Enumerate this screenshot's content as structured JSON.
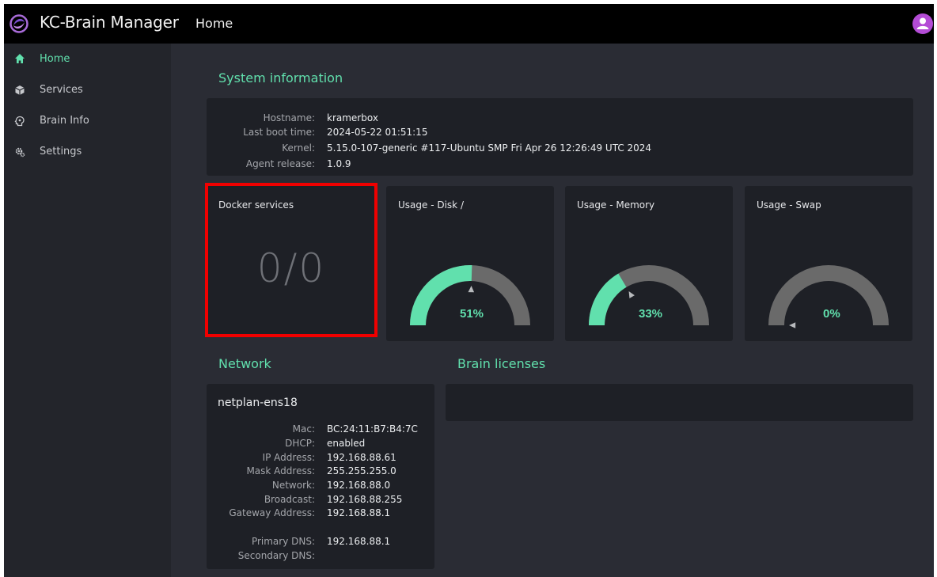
{
  "app": {
    "title": "KC-Brain Manager",
    "page_heading": "Home"
  },
  "sidebar": {
    "items": [
      {
        "label": "Home",
        "icon": "home-icon",
        "active": true
      },
      {
        "label": "Services",
        "icon": "cube-icon",
        "active": false
      },
      {
        "label": "Brain Info",
        "icon": "brain-info-icon",
        "active": false
      },
      {
        "label": "Settings",
        "icon": "gear-icon",
        "active": false
      }
    ]
  },
  "system_info": {
    "title": "System information",
    "rows": [
      {
        "key": "Hostname:",
        "value": "kramerbox"
      },
      {
        "key": "Last boot time:",
        "value": "2024-05-22 01:51:15"
      },
      {
        "key": "Kernel:",
        "value": "5.15.0-107-generic #117-Ubuntu SMP Fri Apr 26 12:26:49 UTC 2024"
      },
      {
        "key": "Agent release:",
        "value": "1.0.9"
      }
    ]
  },
  "docker": {
    "title": "Docker services",
    "value": "0/0"
  },
  "gauges": [
    {
      "title": "Usage - Disk /",
      "value_label": "51%",
      "percent": 51
    },
    {
      "title": "Usage - Memory",
      "value_label": "33%",
      "percent": 33
    },
    {
      "title": "Usage - Swap",
      "value_label": "0%",
      "percent": 0
    }
  ],
  "network": {
    "title": "Network",
    "interface": "netplan-ens18",
    "rows": [
      {
        "key": "Mac:",
        "value": "BC:24:11:B7:B4:7C"
      },
      {
        "key": "DHCP:",
        "value": "enabled"
      },
      {
        "key": "IP Address:",
        "value": "192.168.88.61"
      },
      {
        "key": "Mask Address:",
        "value": "255.255.255.0"
      },
      {
        "key": "Network:",
        "value": "192.168.88.0"
      },
      {
        "key": "Broadcast:",
        "value": "192.168.88.255"
      },
      {
        "key": "Gateway Address:",
        "value": "192.168.88.1"
      },
      {
        "key": "Primary DNS:",
        "value": "192.168.88.1"
      },
      {
        "key": "Secondary DNS:",
        "value": ""
      }
    ]
  },
  "licenses": {
    "title": "Brain licenses"
  },
  "colors": {
    "accent": "#61e0ad",
    "gauge_track": "#6a6a6a",
    "highlight": "#f00000",
    "avatar": "#b44cd6"
  }
}
